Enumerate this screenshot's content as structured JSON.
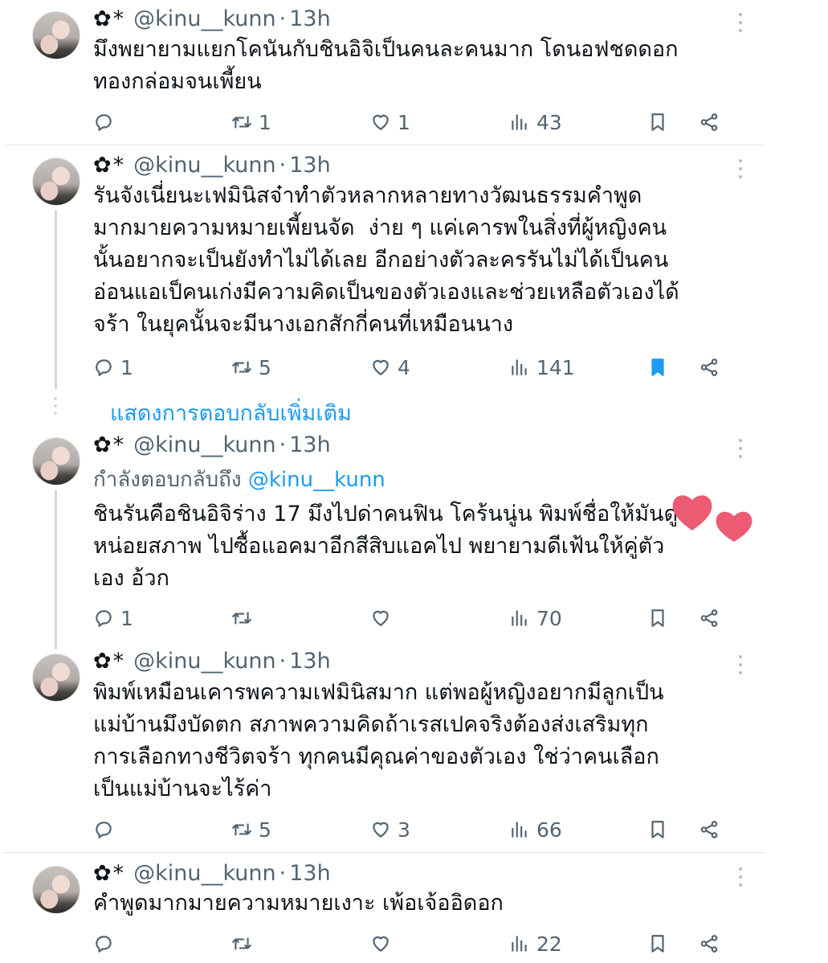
{
  "author": {
    "flower": "✿",
    "star": "*",
    "handle": "@kinu__kunn",
    "separator": "·",
    "time": "13h"
  },
  "show_more_replies": "แสดงการตอบกลับเพิ่มเติม",
  "tweets": [
    {
      "text": "มึงพยายามแยกโคนันกับชินอิจิเป็นคนละคนมาก โดนอฟชดดอก\nทองกล่อมจนเพี้ยน",
      "replying_label": "",
      "replying_to": "",
      "replies": "",
      "retweets": "1",
      "likes": "1",
      "views": "43",
      "bookmarked": false
    },
    {
      "text": "รันจังเนี่ยนะเฟมินิสจ๋าทำตัวหลากหลายทางวัฒนธรรมคำพูด\nมากมายความหมายเพี้ยนจัด  ง่าย ๆ แค่เคารพในสิ่งที่ผู้หญิงคน\nนั้นอยากจะเป็นยังทำไม่ได้เลย อีกอย่างตัวละครรันไม่ได้เป็นคน\nอ่อนแอเป็คนเก่งมีความคิดเป็นของตัวเองและช่วยเหลือตัวเองได้\nจร้า ในยุคนั้นจะมีนางเอกสักกี่คนที่เหมือนนาง",
      "replying_label": "",
      "replying_to": "",
      "replies": "1",
      "retweets": "5",
      "likes": "4",
      "views": "141",
      "bookmarked": true
    },
    {
      "text": "ชินรันคือชินอิจิร่าง 17 มึงไปด่าคนฟิน โคร้นนู่น พิมพ์ชื่อให้มันดู\nหน่อยสภาพ ไปซื้อแอคมาอีกสีสิบแอคไป พยายามดีเฟ้นให้คู่ตัว\nเอง อ้วก",
      "replying_label": "กำลังตอบกลับถึง",
      "replying_to": "@kinu__kunn",
      "replies": "1",
      "retweets": "",
      "likes": "",
      "views": "70",
      "bookmarked": false
    },
    {
      "text": "พิมพ์เหมือนเคารพความเฟมินิสมาก แต่พอผู้หญิงอยากมีลูกเป็น\nแม่บ้านมึงบัดตก สภาพความคิดถ้าเรสเปคจริงต้องส่งเสริมทุก\nการเลือกทางชีวิตจร้า ทุกคนมีคุณค่าของตัวเอง ใช่ว่าคนเลือก\nเป็นแม่บ้านจะไร้ค่า",
      "replying_label": "",
      "replying_to": "",
      "replies": "",
      "retweets": "5",
      "likes": "3",
      "views": "66",
      "bookmarked": false
    },
    {
      "text": "คำพูดมากมายความหมายเงาะ เพ้อเจ้ออิดอก",
      "replying_label": "",
      "replying_to": "",
      "replies": "",
      "retweets": "",
      "likes": "",
      "views": "22",
      "bookmarked": false
    }
  ],
  "icons": {
    "reply": "reply-icon",
    "retweet": "retweet-icon",
    "like": "heart-icon",
    "views": "views-icon",
    "bookmark": "bookmark-icon",
    "share": "share-icon",
    "more": "more-icon"
  },
  "colors": {
    "accent": "#1d9bf0",
    "muted": "#536471",
    "text": "#0f1419",
    "sticker_heart": "#ec5a74"
  }
}
